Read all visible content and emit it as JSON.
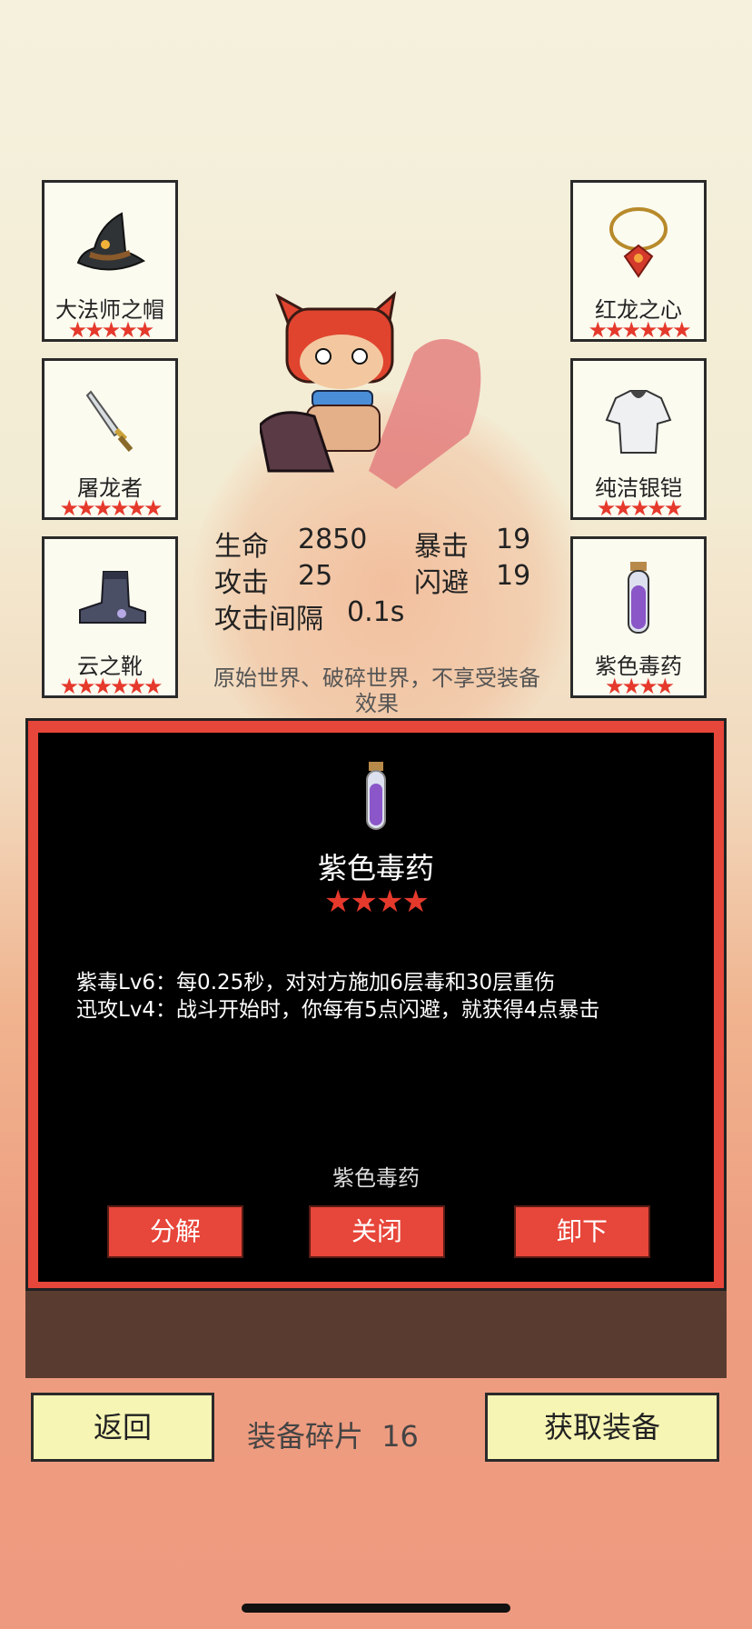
{
  "equipment": {
    "left": [
      {
        "name": "大法师之帽",
        "stars": "★★★★★",
        "icon": "wizard-hat-icon"
      },
      {
        "name": "屠龙者",
        "stars": "★★★★★★",
        "icon": "dagger-icon"
      },
      {
        "name": "云之靴",
        "stars": "★★★★★★",
        "icon": "boot-icon"
      }
    ],
    "right": [
      {
        "name": "红龙之心",
        "stars": "★★★★★★",
        "icon": "amulet-icon"
      },
      {
        "name": "纯洁银铠",
        "stars": "★★★★★",
        "icon": "armor-icon"
      },
      {
        "name": "紫色毒药",
        "stars": "★★★★",
        "icon": "potion-icon"
      }
    ]
  },
  "stats": {
    "hp_label": "生命",
    "hp": "2850",
    "crit_label": "暴击",
    "crit": "19",
    "atk_label": "攻击",
    "atk": "25",
    "dodge_label": "闪避",
    "dodge": "19",
    "interval_label": "攻击间隔",
    "interval": "0.1s"
  },
  "note": "原始世界、破碎世界，不享受装备效果",
  "popup": {
    "icon": "potion-icon",
    "title": "紫色毒药",
    "stars": "★★★★",
    "desc_line1": "紫毒Lv6：每0.25秒，对对方施加6层毒和30层重伤",
    "desc_line2": "迅攻Lv4：战斗开始时，你每有5点闪避，就获得4点暴击",
    "item_name": "紫色毒药",
    "buttons": {
      "decompose": "分解",
      "close": "关闭",
      "unequip": "卸下"
    }
  },
  "footer": {
    "back": "返回",
    "shards_label": "装备碎片",
    "shards_count": "16",
    "get": "获取装备"
  },
  "colors": {
    "accent_red": "#e7463a",
    "star_red": "#e5392c",
    "button_yellow": "#f7f5b4"
  }
}
